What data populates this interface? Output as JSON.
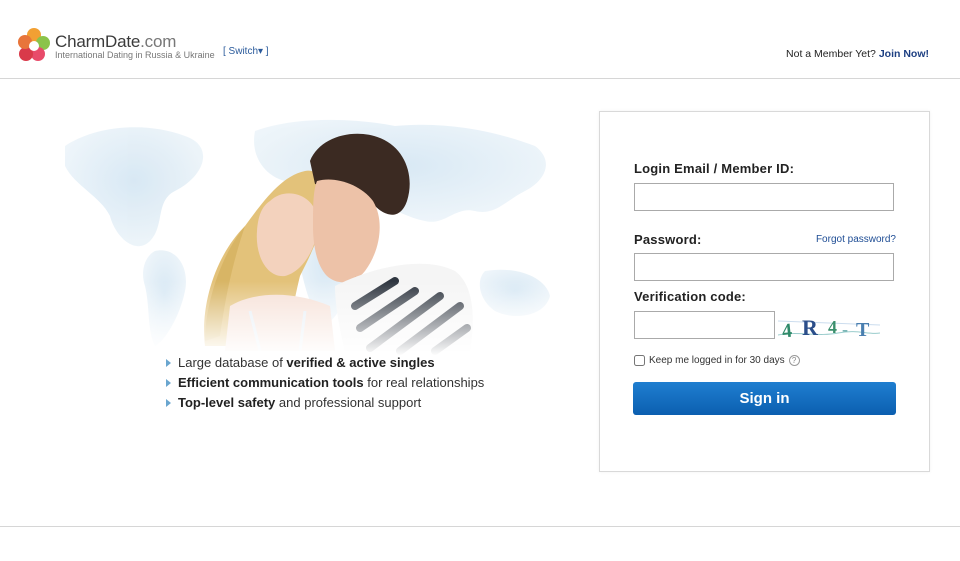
{
  "header": {
    "brand_name": "CharmDate",
    "brand_suffix": ".com",
    "tagline": "International Dating in Russia & Ukraine",
    "switch_label": "[ Switch▾ ]",
    "member_prompt": "Not a Member Yet?",
    "join_label": "Join Now!"
  },
  "features": [
    {
      "pre": "Large database of ",
      "bold": "verified & active singles",
      "post": ""
    },
    {
      "pre": "",
      "bold": "Efficient communication tools",
      "post": " for real relationships"
    },
    {
      "pre": "",
      "bold": "Top-level safety",
      "post": " and professional support"
    }
  ],
  "login": {
    "email_label": "Login Email / Member ID:",
    "email_value": "",
    "password_label": "Password:",
    "password_value": "",
    "forgot_label": "Forgot password?",
    "verification_label": "Verification code:",
    "verification_value": "",
    "captcha_text": "4R4-T",
    "keep_label": "Keep me logged in for 30 days",
    "help_glyph": "?",
    "signin_label": "Sign in"
  },
  "colors": {
    "accent": "#0b5fb0",
    "link": "#1d3f82",
    "map": "#dbe9f4"
  }
}
